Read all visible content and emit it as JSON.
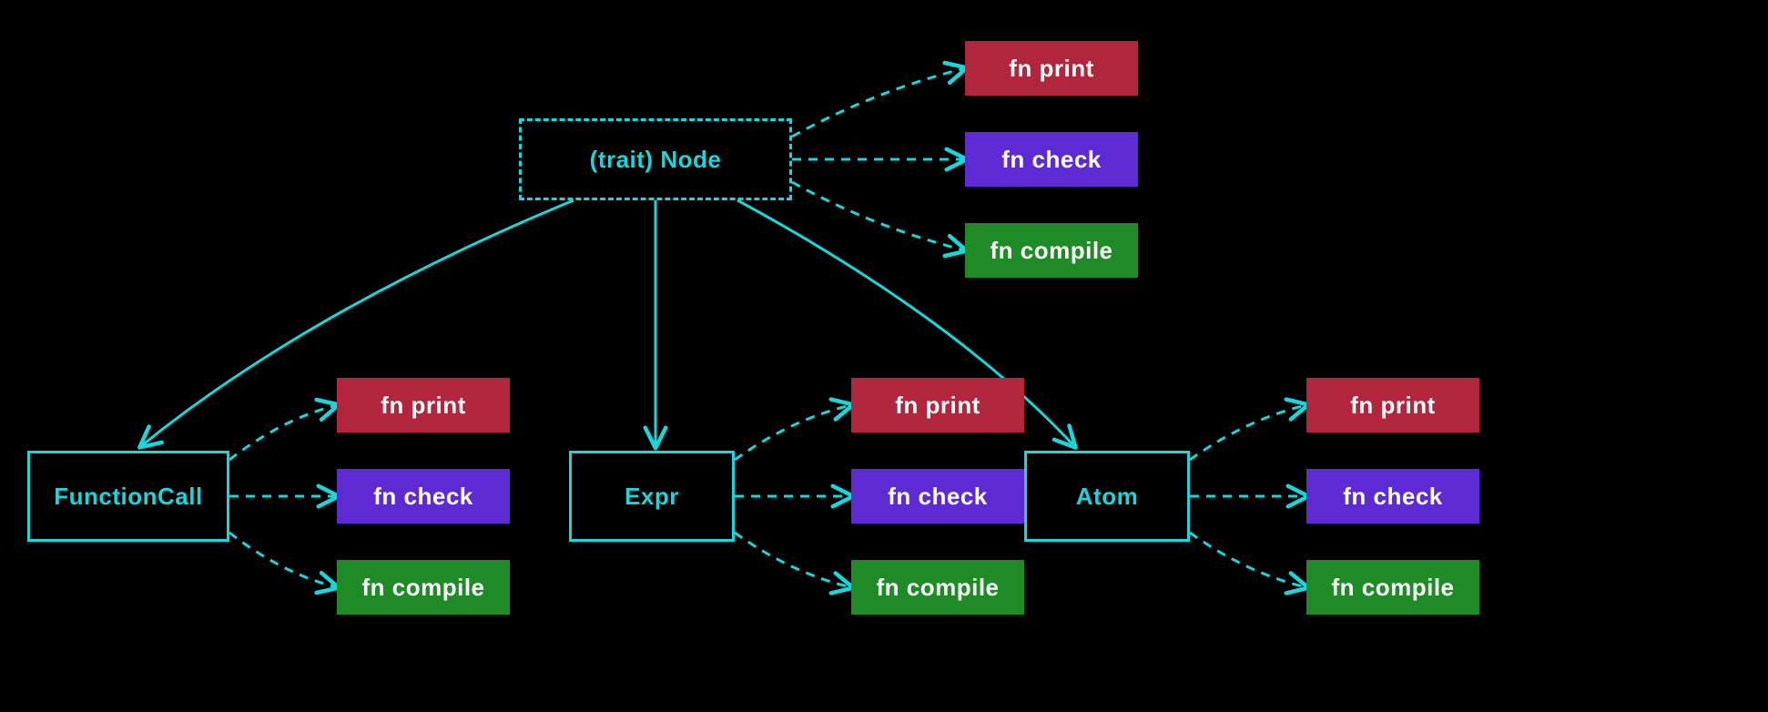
{
  "colors": {
    "background": "#000000",
    "stroke": "#18d6da",
    "fn_print": "#b2263d",
    "fn_check": "#5e2ad4",
    "fn_compile": "#1f8b27",
    "fn_text": "#ffffff"
  },
  "trait": {
    "label": "(trait) Node"
  },
  "trait_methods": {
    "print": {
      "label": "fn print"
    },
    "check": {
      "label": "fn check"
    },
    "compile": {
      "label": "fn compile"
    }
  },
  "impls": {
    "function_call": {
      "label": "FunctionCall",
      "methods": {
        "print": {
          "label": "fn print"
        },
        "check": {
          "label": "fn check"
        },
        "compile": {
          "label": "fn compile"
        }
      }
    },
    "expr": {
      "label": "Expr",
      "methods": {
        "print": {
          "label": "fn print"
        },
        "check": {
          "label": "fn check"
        },
        "compile": {
          "label": "fn compile"
        }
      }
    },
    "atom": {
      "label": "Atom",
      "methods": {
        "print": {
          "label": "fn print"
        },
        "check": {
          "label": "fn check"
        },
        "compile": {
          "label": "fn compile"
        }
      }
    }
  },
  "edges": {
    "inheritance": [
      {
        "from": "trait",
        "to": "function_call",
        "style": "solid"
      },
      {
        "from": "trait",
        "to": "expr",
        "style": "solid"
      },
      {
        "from": "trait",
        "to": "atom",
        "style": "solid"
      }
    ],
    "method_links": [
      {
        "from": "trait",
        "to": "trait_methods.print",
        "style": "dashed"
      },
      {
        "from": "trait",
        "to": "trait_methods.check",
        "style": "dashed"
      },
      {
        "from": "trait",
        "to": "trait_methods.compile",
        "style": "dashed"
      },
      {
        "from": "function_call",
        "to": "function_call.methods.print",
        "style": "dashed"
      },
      {
        "from": "function_call",
        "to": "function_call.methods.check",
        "style": "dashed"
      },
      {
        "from": "function_call",
        "to": "function_call.methods.compile",
        "style": "dashed"
      },
      {
        "from": "expr",
        "to": "expr.methods.print",
        "style": "dashed"
      },
      {
        "from": "expr",
        "to": "expr.methods.check",
        "style": "dashed"
      },
      {
        "from": "expr",
        "to": "expr.methods.compile",
        "style": "dashed"
      },
      {
        "from": "atom",
        "to": "atom.methods.print",
        "style": "dashed"
      },
      {
        "from": "atom",
        "to": "atom.methods.check",
        "style": "dashed"
      },
      {
        "from": "atom",
        "to": "atom.methods.compile",
        "style": "dashed"
      }
    ]
  }
}
